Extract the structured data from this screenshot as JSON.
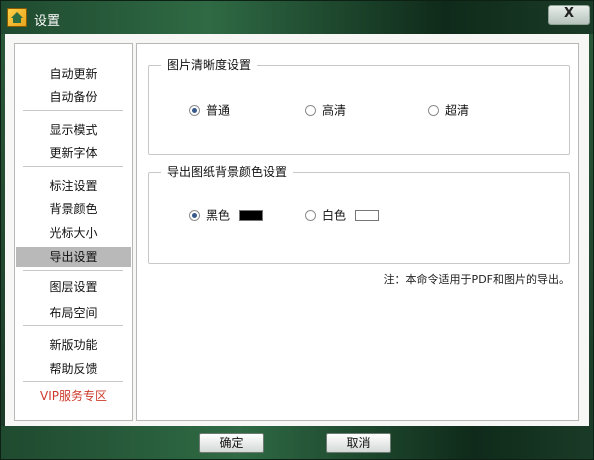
{
  "window": {
    "title": "设置",
    "close_label": "X"
  },
  "sidebar": {
    "items": [
      {
        "label": "自动更新"
      },
      {
        "label": "自动备份"
      },
      {
        "label": "显示模式"
      },
      {
        "label": "更新字体"
      },
      {
        "label": "标注设置"
      },
      {
        "label": "背景颜色"
      },
      {
        "label": "光标大小"
      },
      {
        "label": "导出设置",
        "active": true
      },
      {
        "label": "图层设置"
      },
      {
        "label": "布局空间"
      },
      {
        "label": "新版功能"
      },
      {
        "label": "帮助反馈"
      },
      {
        "label": "VIP服务专区",
        "color": "#cc3a2a"
      }
    ]
  },
  "clarity_group": {
    "title": "图片清晰度设置",
    "options": [
      {
        "label": "普通",
        "checked": true
      },
      {
        "label": "高清",
        "checked": false
      },
      {
        "label": "超清",
        "checked": false
      }
    ]
  },
  "background_group": {
    "title": "导出图纸背景颜色设置",
    "options": [
      {
        "label": "黑色",
        "checked": true,
        "swatch": "#000000"
      },
      {
        "label": "白色",
        "checked": false,
        "swatch": "#ffffff"
      }
    ]
  },
  "note": "注：本命令适用于PDF和图片的导出。",
  "footer": {
    "ok_label": "确定",
    "cancel_label": "取消"
  },
  "colors": {
    "titlebar": "#2f6a44",
    "active_nav": "#b9b9b9",
    "vip": "#cc3a2a"
  }
}
